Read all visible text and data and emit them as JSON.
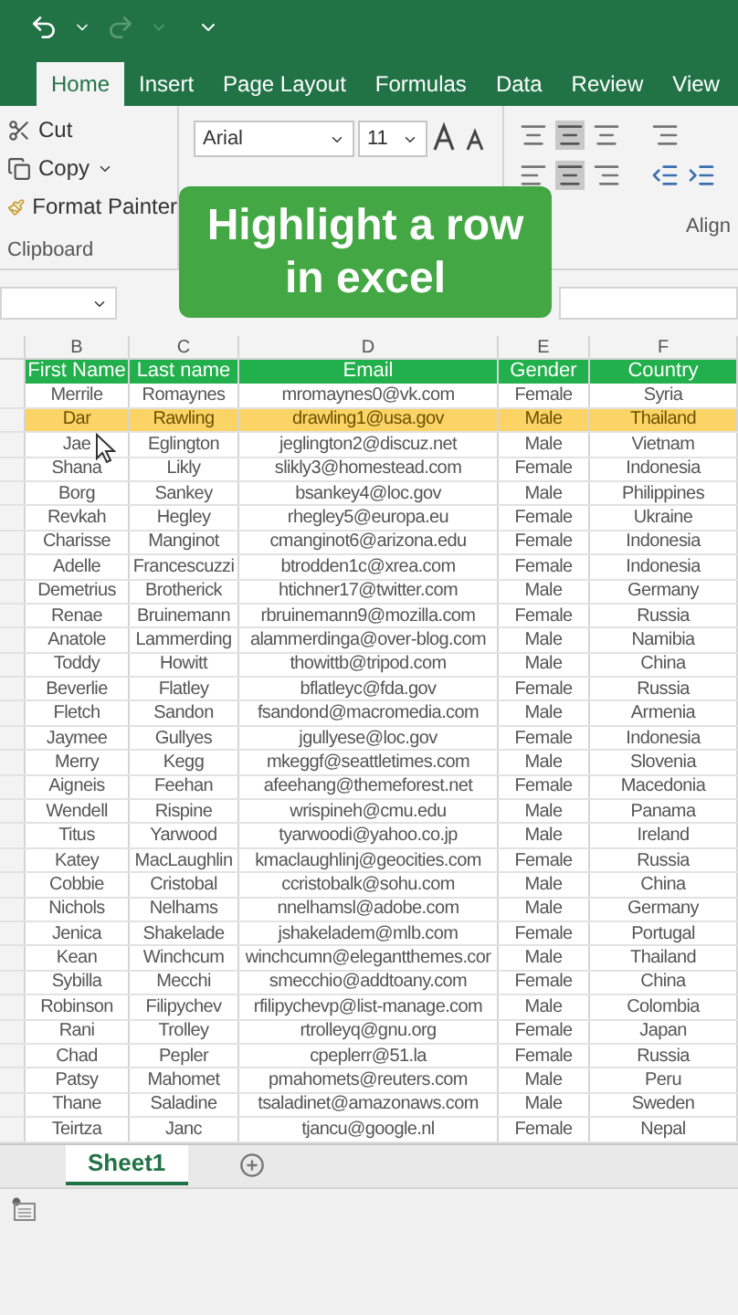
{
  "ribbon_tabs": [
    {
      "label": "Home",
      "selected": true
    },
    {
      "label": "Insert",
      "selected": false
    },
    {
      "label": "Page Layout",
      "selected": false
    },
    {
      "label": "Formulas",
      "selected": false
    },
    {
      "label": "Data",
      "selected": false
    },
    {
      "label": "Review",
      "selected": false
    },
    {
      "label": "View",
      "selected": false
    }
  ],
  "clipboard": {
    "cut": "Cut",
    "copy": "Copy",
    "format_painter": "Format Painter",
    "group_label": "Clipboard"
  },
  "font": {
    "name": "Arial",
    "size": "11"
  },
  "alignment": {
    "group_label": "Align"
  },
  "banner": "Highlight a row in excel",
  "column_letters": [
    "B",
    "C",
    "D",
    "E",
    "F"
  ],
  "table": {
    "columns": [
      "First Name",
      "Last name",
      "Email",
      "Gender",
      "Country"
    ],
    "rows": [
      {
        "cells": [
          "Merrile",
          "Romaynes",
          "mromaynes0@vk.com",
          "Female",
          "Syria"
        ],
        "highlighted": false
      },
      {
        "cells": [
          "Dar",
          "Rawling",
          "drawling1@usa.gov",
          "Male",
          "Thailand"
        ],
        "highlighted": true
      },
      {
        "cells": [
          "Jae",
          "Eglington",
          "jeglington2@discuz.net",
          "Male",
          "Vietnam"
        ],
        "highlighted": false
      },
      {
        "cells": [
          "Shana",
          "Likly",
          "slikly3@homestead.com",
          "Female",
          "Indonesia"
        ],
        "highlighted": false
      },
      {
        "cells": [
          "Borg",
          "Sankey",
          "bsankey4@loc.gov",
          "Male",
          "Philippines"
        ],
        "highlighted": false
      },
      {
        "cells": [
          "Revkah",
          "Hegley",
          "rhegley5@europa.eu",
          "Female",
          "Ukraine"
        ],
        "highlighted": false
      },
      {
        "cells": [
          "Charisse",
          "Manginot",
          "cmanginot6@arizona.edu",
          "Female",
          "Indonesia"
        ],
        "highlighted": false
      },
      {
        "cells": [
          "Adelle",
          "Francescuzzi",
          "btrodden1c@xrea.com",
          "Female",
          "Indonesia"
        ],
        "highlighted": false
      },
      {
        "cells": [
          "Demetrius",
          "Brotherick",
          "htichner17@twitter.com",
          "Male",
          "Germany"
        ],
        "highlighted": false
      },
      {
        "cells": [
          "Renae",
          "Bruinemann",
          "rbruinemann9@mozilla.com",
          "Female",
          "Russia"
        ],
        "highlighted": false
      },
      {
        "cells": [
          "Anatole",
          "Lammerding",
          "alammerdinga@over-blog.com",
          "Male",
          "Namibia"
        ],
        "highlighted": false
      },
      {
        "cells": [
          "Toddy",
          "Howitt",
          "thowittb@tripod.com",
          "Male",
          "China"
        ],
        "highlighted": false
      },
      {
        "cells": [
          "Beverlie",
          "Flatley",
          "bflatleyc@fda.gov",
          "Female",
          "Russia"
        ],
        "highlighted": false
      },
      {
        "cells": [
          "Fletch",
          "Sandon",
          "fsandond@macromedia.com",
          "Male",
          "Armenia"
        ],
        "highlighted": false
      },
      {
        "cells": [
          "Jaymee",
          "Gullyes",
          "jgullyese@loc.gov",
          "Female",
          "Indonesia"
        ],
        "highlighted": false
      },
      {
        "cells": [
          "Merry",
          "Kegg",
          "mkeggf@seattletimes.com",
          "Male",
          "Slovenia"
        ],
        "highlighted": false
      },
      {
        "cells": [
          "Aigneis",
          "Feehan",
          "afeehang@themeforest.net",
          "Female",
          "Macedonia"
        ],
        "highlighted": false
      },
      {
        "cells": [
          "Wendell",
          "Rispine",
          "wrispineh@cmu.edu",
          "Male",
          "Panama"
        ],
        "highlighted": false
      },
      {
        "cells": [
          "Titus",
          "Yarwood",
          "tyarwoodi@yahoo.co.jp",
          "Male",
          "Ireland"
        ],
        "highlighted": false
      },
      {
        "cells": [
          "Katey",
          "MacLaughlin",
          "kmaclaughlinj@geocities.com",
          "Female",
          "Russia"
        ],
        "highlighted": false
      },
      {
        "cells": [
          "Cobbie",
          "Cristobal",
          "ccristobalk@sohu.com",
          "Male",
          "China"
        ],
        "highlighted": false
      },
      {
        "cells": [
          "Nichols",
          "Nelhams",
          "nnelhamsl@adobe.com",
          "Male",
          "Germany"
        ],
        "highlighted": false
      },
      {
        "cells": [
          "Jenica",
          "Shakelade",
          "jshakeladem@mlb.com",
          "Female",
          "Portugal"
        ],
        "highlighted": false
      },
      {
        "cells": [
          "Kean",
          "Winchcum",
          "winchcumn@elegantthemes.cor",
          "Male",
          "Thailand"
        ],
        "highlighted": false
      },
      {
        "cells": [
          "Sybilla",
          "Mecchi",
          "smecchio@addtoany.com",
          "Female",
          "China"
        ],
        "highlighted": false
      },
      {
        "cells": [
          "Robinson",
          "Filipychev",
          "rfilipychevp@list-manage.com",
          "Male",
          "Colombia"
        ],
        "highlighted": false
      },
      {
        "cells": [
          "Rani",
          "Trolley",
          "rtrolleyq@gnu.org",
          "Female",
          "Japan"
        ],
        "highlighted": false
      },
      {
        "cells": [
          "Chad",
          "Pepler",
          "cpeplerr@51.la",
          "Female",
          "Russia"
        ],
        "highlighted": false
      },
      {
        "cells": [
          "Patsy",
          "Mahomet",
          "pmahomets@reuters.com",
          "Male",
          "Peru"
        ],
        "highlighted": false
      },
      {
        "cells": [
          "Thane",
          "Saladine",
          "tsaladinet@amazonaws.com",
          "Male",
          "Sweden"
        ],
        "highlighted": false
      },
      {
        "cells": [
          "Teirtza",
          "Janc",
          "tjancu@google.nl",
          "Female",
          "Nepal"
        ],
        "highlighted": false
      }
    ]
  },
  "sheet_tabs": [
    {
      "label": "Sheet1",
      "selected": true
    }
  ]
}
